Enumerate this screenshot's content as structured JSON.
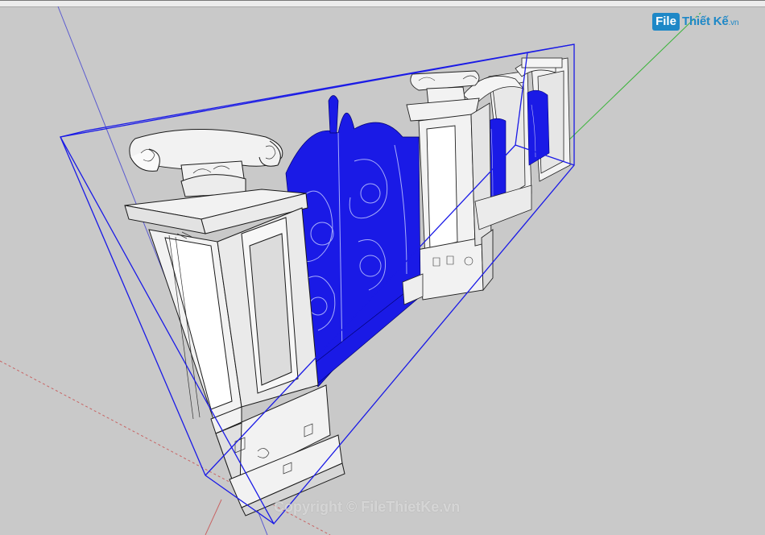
{
  "watermark": {
    "logo_file": "File",
    "logo_brand": "Thiết Kế",
    "logo_ext": ".vn",
    "copyright": "Copyright © FileThietKe.vn"
  },
  "colors": {
    "background": "#c9c9c9",
    "selection": "#1a1ae6",
    "axis_red": "#c85050",
    "axis_green": "#3cb43c",
    "axis_blue": "#5050c8",
    "model_face": "#f2f2f2",
    "logo_blue": "#1e88c7"
  },
  "icons": [
    "model-gate-3d",
    "axis-lines"
  ]
}
